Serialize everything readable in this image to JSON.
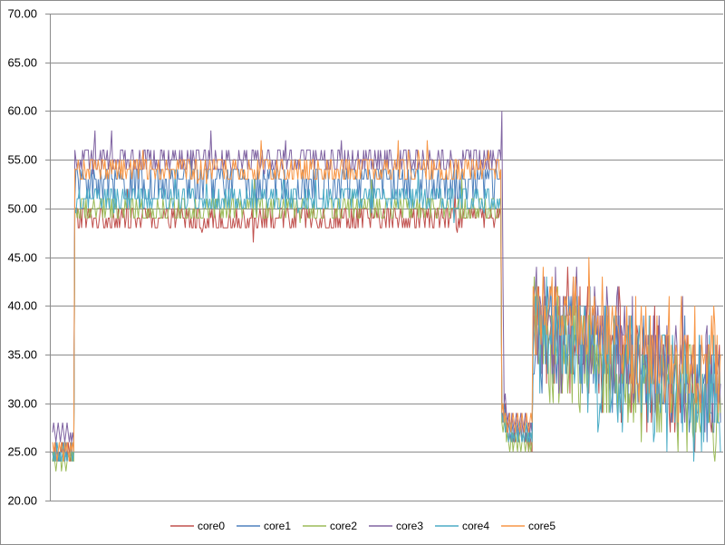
{
  "chart_data": {
    "type": "line",
    "title": "",
    "xlabel": "",
    "ylabel": "",
    "ylim": [
      20,
      70
    ],
    "yticks": [
      "20.00",
      "25.00",
      "30.00",
      "35.00",
      "40.00",
      "45.00",
      "50.00",
      "55.00",
      "60.00",
      "65.00",
      "70.00"
    ],
    "grid": "horizontal",
    "legend_position": "bottom",
    "x_count": 600,
    "series": [
      {
        "name": "core0",
        "color": "#c0504d",
        "segments": [
          {
            "from": 0,
            "to": 19,
            "values": [
              25,
              24,
              26,
              25,
              24,
              25,
              24,
              25,
              25,
              26,
              25,
              24,
              25,
              24,
              26,
              25,
              24,
              25,
              24,
              25
            ]
          },
          {
            "from": 20,
            "to": 402,
            "base": 49.0,
            "amp": 1.1
          },
          {
            "from": 403,
            "to": 430,
            "values": [
              28,
              29,
              28,
              30,
              27,
              28,
              26,
              27,
              26,
              27,
              26,
              27,
              26,
              28,
              27,
              26,
              27,
              28,
              26,
              27,
              28,
              26,
              27,
              26,
              25,
              27,
              26,
              25
            ]
          },
          {
            "from": 431,
            "to": 599,
            "base": 33.0,
            "amp": 4.5,
            "spread": 3.0
          }
        ]
      },
      {
        "name": "core1",
        "color": "#4f81bd",
        "segments": [
          {
            "from": 0,
            "to": 19,
            "values": [
              24,
              25,
              24,
              26,
              25,
              24,
              25,
              24,
              26,
              25,
              24,
              25,
              26,
              24,
              25,
              24,
              25,
              26,
              24,
              25
            ]
          },
          {
            "from": 20,
            "to": 402,
            "base": 52.5,
            "amp": 1.2
          },
          {
            "from": 403,
            "to": 430,
            "values": [
              29,
              28,
              30,
              29,
              28,
              27,
              28,
              27,
              26,
              28,
              27,
              26,
              27,
              28,
              27,
              26,
              28,
              27,
              26,
              27,
              28,
              27,
              26,
              27,
              26,
              27,
              28,
              27
            ]
          },
          {
            "from": 431,
            "to": 599,
            "base": 32.5,
            "amp": 4.5,
            "spread": 3.0
          }
        ]
      },
      {
        "name": "core2",
        "color": "#9bbb59",
        "segments": [
          {
            "from": 0,
            "to": 19,
            "values": [
              24,
              25,
              24,
              23,
              24,
              25,
              24,
              25,
              23,
              24,
              25,
              24,
              23,
              24,
              25,
              24,
              25,
              24,
              25,
              24
            ]
          },
          {
            "from": 20,
            "to": 402,
            "base": 50.3,
            "amp": 1.0
          },
          {
            "from": 403,
            "to": 430,
            "values": [
              28,
              27,
              28,
              29,
              26,
              27,
              26,
              25,
              26,
              27,
              25,
              26,
              27,
              26,
              25,
              27,
              26,
              25,
              26,
              27,
              26,
              25,
              26,
              27,
              25,
              26,
              25,
              26
            ]
          },
          {
            "from": 431,
            "to": 599,
            "base": 31.5,
            "amp": 4.5,
            "spread": 3.0
          }
        ]
      },
      {
        "name": "core3",
        "color": "#8064a2",
        "segments": [
          {
            "from": 0,
            "to": 19,
            "values": [
              27,
              28,
              27,
              26,
              27,
              28,
              27,
              26,
              27,
              28,
              27,
              26,
              27,
              28,
              27,
              26,
              27,
              26,
              27,
              26
            ]
          },
          {
            "from": 20,
            "to": 402,
            "base": 55.2,
            "amp": 1.1
          },
          {
            "from": 403,
            "to": 430,
            "values": [
              60,
              42,
              30,
              31,
              29,
              28,
              29,
              28,
              27,
              29,
              28,
              27,
              28,
              29,
              28,
              27,
              28,
              29,
              28,
              27,
              28,
              29,
              28,
              27,
              28,
              27,
              28,
              27
            ]
          },
          {
            "from": 431,
            "to": 599,
            "base": 34.0,
            "amp": 4.5,
            "spread": 3.0
          }
        ]
      },
      {
        "name": "core4",
        "color": "#4bacc6",
        "segments": [
          {
            "from": 0,
            "to": 19,
            "values": [
              25,
              24,
              25,
              24,
              26,
              25,
              24,
              25,
              24,
              25,
              26,
              24,
              25,
              24,
              25,
              24,
              26,
              25,
              24,
              25
            ]
          },
          {
            "from": 20,
            "to": 402,
            "base": 51.4,
            "amp": 1.2
          },
          {
            "from": 403,
            "to": 430,
            "values": [
              29,
              28,
              29,
              27,
              28,
              27,
              26,
              27,
              28,
              26,
              27,
              26,
              27,
              28,
              26,
              27,
              28,
              27,
              26,
              27,
              26,
              27,
              28,
              26,
              27,
              26,
              27,
              26
            ]
          },
          {
            "from": 431,
            "to": 599,
            "base": 32.0,
            "amp": 4.5,
            "spread": 3.0
          }
        ]
      },
      {
        "name": "core5",
        "color": "#f79646",
        "segments": [
          {
            "from": 0,
            "to": 19,
            "values": [
              26,
              25,
              26,
              25,
              24,
              25,
              26,
              25,
              26,
              25,
              24,
              26,
              25,
              26,
              25,
              24,
              26,
              25,
              26,
              25
            ]
          },
          {
            "from": 20,
            "to": 402,
            "base": 53.8,
            "amp": 1.2
          },
          {
            "from": 403,
            "to": 430,
            "values": [
              29,
              30,
              28,
              29,
              28,
              27,
              28,
              29,
              27,
              28,
              29,
              28,
              27,
              28,
              29,
              28,
              27,
              28,
              29,
              28,
              27,
              28,
              29,
              28,
              27,
              28,
              29,
              28
            ]
          },
          {
            "from": 431,
            "to": 599,
            "base": 35.0,
            "amp": 4.5,
            "spread": 3.0
          }
        ]
      }
    ]
  }
}
